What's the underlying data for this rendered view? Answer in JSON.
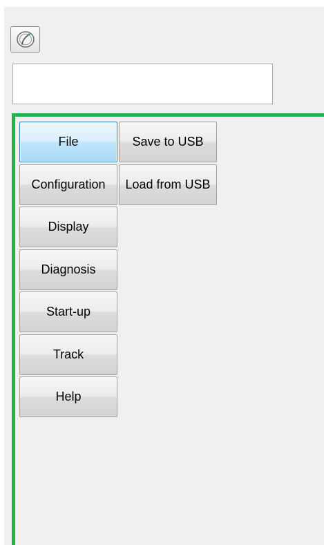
{
  "toolbar": {
    "icon": "gauge-icon"
  },
  "input": {
    "value": ""
  },
  "menu": {
    "items": [
      {
        "label": "File"
      },
      {
        "label": "Configuration"
      },
      {
        "label": "Display"
      },
      {
        "label": "Diagnosis"
      },
      {
        "label": "Start-up"
      },
      {
        "label": "Track"
      },
      {
        "label": "Help"
      }
    ],
    "selected": "File"
  },
  "submenu": {
    "items": [
      {
        "label": "Save to USB"
      },
      {
        "label": "Load from USB"
      }
    ]
  },
  "colors": {
    "frame_border": "#22b14c",
    "panel_background": "#f0f0f0",
    "selected_border": "#3c7fb1"
  }
}
